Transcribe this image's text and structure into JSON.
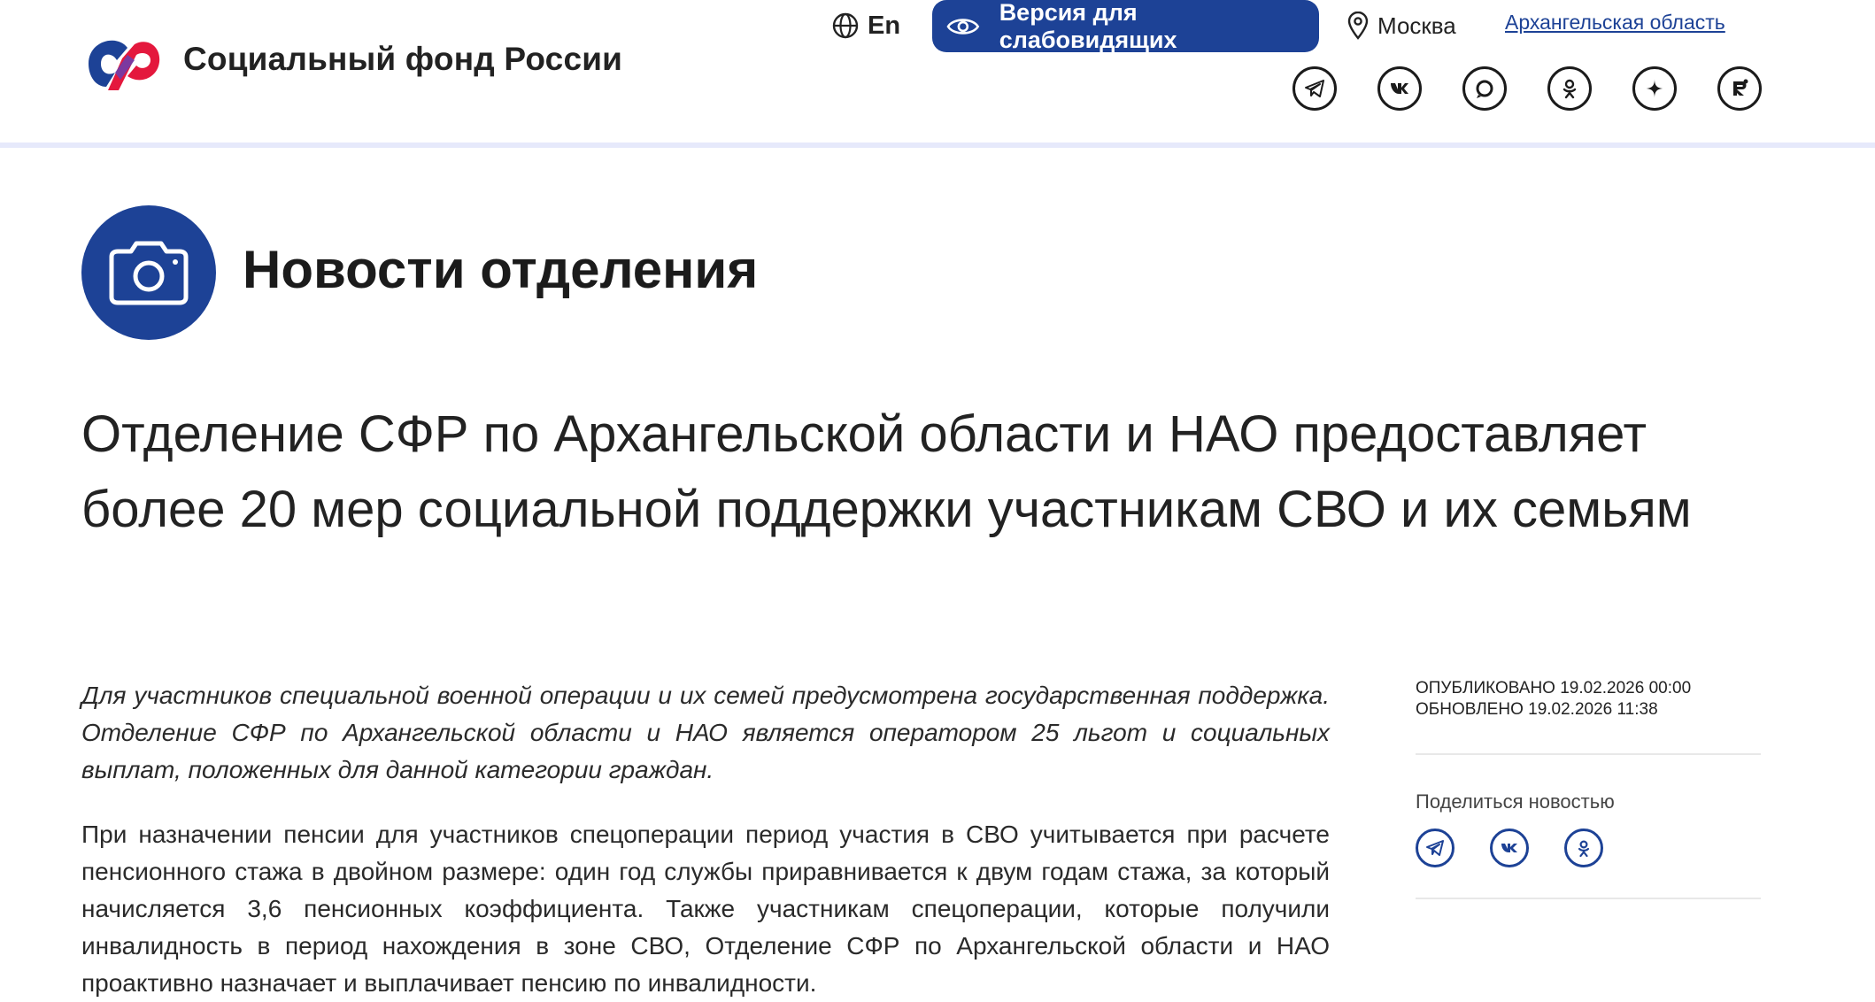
{
  "header": {
    "brand": "Социальный фонд России",
    "lang": "En",
    "vision_button": "Версия для слабовидящих",
    "city": "Москва",
    "region": "Архангельская область",
    "socials": [
      "telegram-icon",
      "vk-icon",
      "max-icon",
      "odnoklassniki-icon",
      "dzen-icon",
      "rutube-icon"
    ],
    "colors": {
      "brand_blue": "#1d4296",
      "logo_red": "#e4183d"
    }
  },
  "section": {
    "icon": "camera-icon",
    "title": "Новости отделения"
  },
  "article": {
    "headline": "Отделение СФР по Архангельской области и НАО предоставляет более 20 мер социальной поддержки участникам СВО и их семьям",
    "lead": "Для участников специальной военной операции и их семей предусмотрена государственная поддержка. Отделение СФР по Архангельской области и НАО является оператором 25  льгот и социальных выплат, положенных для данной категории граждан.",
    "body": "При назначении пенсии  для участников  спецоперации период участия в СВО учитывается при расчете пенсионного стажа в двойном размере: один год службы приравнивается к двум годам стажа, за который начисляется 3,6 пенсионных коэффициента. Также участникам спецоперации, которые получили инвалидность в период нахождения в зоне СВО, Отделение СФР по Архангельской области и НАО проактивно назначает и выплачивает пенсию по инвалидности."
  },
  "sidebar": {
    "published": "Опубликовано 19.02.2026 00:00",
    "updated": "Обновлено 19.02.2026 11:38",
    "share_label": "Поделиться новостью",
    "share_icons": [
      "telegram-icon",
      "vk-icon",
      "odnoklassniki-icon"
    ]
  }
}
